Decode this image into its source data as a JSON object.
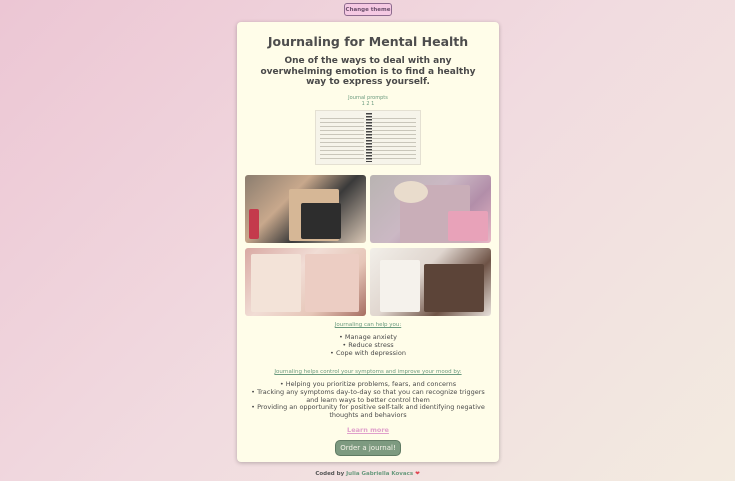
{
  "theme_button": "Change theme",
  "card": {
    "title": "Journaling for Mental Health",
    "subtitle": "One of the ways to deal with any overwhelming emotion is to find a healthy way to express yourself.",
    "prompts_label": "Journal prompts",
    "prompts_sublabel": "1 2 1",
    "help_heading": "Journaling can help you:",
    "help_items": [
      "Manage anxiety",
      "Reduce stress",
      "Cope with depression"
    ],
    "mood_heading": "Journaling helps control your symptoms and improve your mood by:",
    "mood_items": [
      "Helping you prioritize problems, fears, and concerns",
      "Tracking any symptoms day-to-day so that you can recognize triggers and learn ways to better control them",
      "Providing an opportunity for positive self-talk and identifying negative thoughts and behaviors"
    ],
    "learn_more": "Learn more",
    "order_button": "Order a journal!"
  },
  "footer": {
    "prefix": "Coded by",
    "author": "Julia Gabriella Kovacs",
    "heart": "❤"
  },
  "colors": {
    "accent_green": "#6a9a7e",
    "button_green": "#7d9a80",
    "card_bg": "#fffde9",
    "link_pink": "#e0a0cb"
  }
}
